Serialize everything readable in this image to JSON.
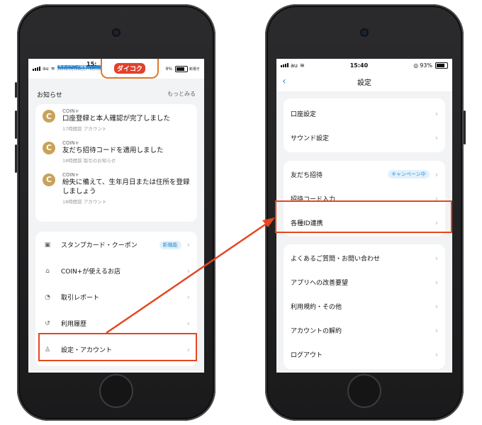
{
  "left_phone": {
    "status": {
      "carrier": "au",
      "banner_line1": "キャンペーン開催",
      "banner_line2": "2024年5月14日(火)〜6月13日(木)",
      "time": "15:",
      "logo": "ダイコク",
      "battery": "9%",
      "right_text": "新規そ"
    },
    "notices_title": "お知らせ",
    "notices_more": "もっとみる",
    "notices": [
      {
        "source": "COIN+",
        "message": "口座登録と本人確認が完了しました",
        "time": "17時間前 アカウント"
      },
      {
        "source": "COIN+",
        "message": "友だち招待コードを適用しました",
        "time": "18時間前 取引のお知らせ"
      },
      {
        "source": "COIN+",
        "message": "紛失に備えて、生年月日または住所を登録しましょう",
        "time": "18時間前 アカウント"
      }
    ],
    "menu": [
      {
        "label": "スタンプカード・クーポン",
        "badge": "新機能",
        "icon": "stamp-card-icon"
      },
      {
        "label": "COIN+が使えるお店",
        "badge": "",
        "icon": "store-icon"
      },
      {
        "label": "取引レポート",
        "badge": "",
        "icon": "report-icon"
      },
      {
        "label": "利用履歴",
        "badge": "",
        "icon": "history-icon"
      },
      {
        "label": "設定・アカウント",
        "badge": "",
        "icon": "person-icon"
      }
    ]
  },
  "right_phone": {
    "status": {
      "time": "15:40",
      "battery": "93%"
    },
    "title": "設定",
    "group1": [
      "口座設定",
      "サウンド設定"
    ],
    "group2": [
      {
        "label": "友だち招待",
        "badge": "キャンペーン中"
      },
      {
        "label": "招待コード入力",
        "badge": ""
      },
      {
        "label": "各種ID連携",
        "badge": ""
      }
    ],
    "group3": [
      "よくあるご質問・お問い合わせ",
      "アプリへの改善要望",
      "利用規約・その他",
      "アカウントの解約",
      "ログアウト"
    ]
  },
  "colors": {
    "highlight": "#e5471e",
    "accent": "#2b8fd6",
    "coin": "#c9a25a"
  }
}
